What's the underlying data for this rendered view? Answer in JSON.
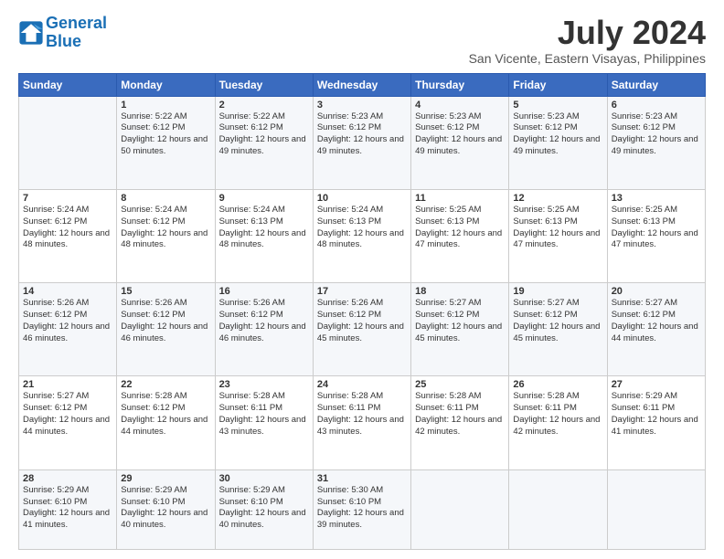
{
  "logo": {
    "line1": "General",
    "line2": "Blue"
  },
  "header": {
    "title": "July 2024",
    "subtitle": "San Vicente, Eastern Visayas, Philippines"
  },
  "days_of_week": [
    "Sunday",
    "Monday",
    "Tuesday",
    "Wednesday",
    "Thursday",
    "Friday",
    "Saturday"
  ],
  "weeks": [
    [
      {
        "day": "",
        "info": ""
      },
      {
        "day": "1",
        "info": "Sunrise: 5:22 AM\nSunset: 6:12 PM\nDaylight: 12 hours\nand 50 minutes."
      },
      {
        "day": "2",
        "info": "Sunrise: 5:22 AM\nSunset: 6:12 PM\nDaylight: 12 hours\nand 49 minutes."
      },
      {
        "day": "3",
        "info": "Sunrise: 5:23 AM\nSunset: 6:12 PM\nDaylight: 12 hours\nand 49 minutes."
      },
      {
        "day": "4",
        "info": "Sunrise: 5:23 AM\nSunset: 6:12 PM\nDaylight: 12 hours\nand 49 minutes."
      },
      {
        "day": "5",
        "info": "Sunrise: 5:23 AM\nSunset: 6:12 PM\nDaylight: 12 hours\nand 49 minutes."
      },
      {
        "day": "6",
        "info": "Sunrise: 5:23 AM\nSunset: 6:12 PM\nDaylight: 12 hours\nand 49 minutes."
      }
    ],
    [
      {
        "day": "7",
        "info": "Sunrise: 5:24 AM\nSunset: 6:12 PM\nDaylight: 12 hours\nand 48 minutes."
      },
      {
        "day": "8",
        "info": "Sunrise: 5:24 AM\nSunset: 6:12 PM\nDaylight: 12 hours\nand 48 minutes."
      },
      {
        "day": "9",
        "info": "Sunrise: 5:24 AM\nSunset: 6:13 PM\nDaylight: 12 hours\nand 48 minutes."
      },
      {
        "day": "10",
        "info": "Sunrise: 5:24 AM\nSunset: 6:13 PM\nDaylight: 12 hours\nand 48 minutes."
      },
      {
        "day": "11",
        "info": "Sunrise: 5:25 AM\nSunset: 6:13 PM\nDaylight: 12 hours\nand 47 minutes."
      },
      {
        "day": "12",
        "info": "Sunrise: 5:25 AM\nSunset: 6:13 PM\nDaylight: 12 hours\nand 47 minutes."
      },
      {
        "day": "13",
        "info": "Sunrise: 5:25 AM\nSunset: 6:13 PM\nDaylight: 12 hours\nand 47 minutes."
      }
    ],
    [
      {
        "day": "14",
        "info": "Sunrise: 5:26 AM\nSunset: 6:12 PM\nDaylight: 12 hours\nand 46 minutes."
      },
      {
        "day": "15",
        "info": "Sunrise: 5:26 AM\nSunset: 6:12 PM\nDaylight: 12 hours\nand 46 minutes."
      },
      {
        "day": "16",
        "info": "Sunrise: 5:26 AM\nSunset: 6:12 PM\nDaylight: 12 hours\nand 46 minutes."
      },
      {
        "day": "17",
        "info": "Sunrise: 5:26 AM\nSunset: 6:12 PM\nDaylight: 12 hours\nand 45 minutes."
      },
      {
        "day": "18",
        "info": "Sunrise: 5:27 AM\nSunset: 6:12 PM\nDaylight: 12 hours\nand 45 minutes."
      },
      {
        "day": "19",
        "info": "Sunrise: 5:27 AM\nSunset: 6:12 PM\nDaylight: 12 hours\nand 45 minutes."
      },
      {
        "day": "20",
        "info": "Sunrise: 5:27 AM\nSunset: 6:12 PM\nDaylight: 12 hours\nand 44 minutes."
      }
    ],
    [
      {
        "day": "21",
        "info": "Sunrise: 5:27 AM\nSunset: 6:12 PM\nDaylight: 12 hours\nand 44 minutes."
      },
      {
        "day": "22",
        "info": "Sunrise: 5:28 AM\nSunset: 6:12 PM\nDaylight: 12 hours\nand 44 minutes."
      },
      {
        "day": "23",
        "info": "Sunrise: 5:28 AM\nSunset: 6:11 PM\nDaylight: 12 hours\nand 43 minutes."
      },
      {
        "day": "24",
        "info": "Sunrise: 5:28 AM\nSunset: 6:11 PM\nDaylight: 12 hours\nand 43 minutes."
      },
      {
        "day": "25",
        "info": "Sunrise: 5:28 AM\nSunset: 6:11 PM\nDaylight: 12 hours\nand 42 minutes."
      },
      {
        "day": "26",
        "info": "Sunrise: 5:28 AM\nSunset: 6:11 PM\nDaylight: 12 hours\nand 42 minutes."
      },
      {
        "day": "27",
        "info": "Sunrise: 5:29 AM\nSunset: 6:11 PM\nDaylight: 12 hours\nand 41 minutes."
      }
    ],
    [
      {
        "day": "28",
        "info": "Sunrise: 5:29 AM\nSunset: 6:10 PM\nDaylight: 12 hours\nand 41 minutes."
      },
      {
        "day": "29",
        "info": "Sunrise: 5:29 AM\nSunset: 6:10 PM\nDaylight: 12 hours\nand 40 minutes."
      },
      {
        "day": "30",
        "info": "Sunrise: 5:29 AM\nSunset: 6:10 PM\nDaylight: 12 hours\nand 40 minutes."
      },
      {
        "day": "31",
        "info": "Sunrise: 5:30 AM\nSunset: 6:10 PM\nDaylight: 12 hours\nand 39 minutes."
      },
      {
        "day": "",
        "info": ""
      },
      {
        "day": "",
        "info": ""
      },
      {
        "day": "",
        "info": ""
      }
    ]
  ]
}
